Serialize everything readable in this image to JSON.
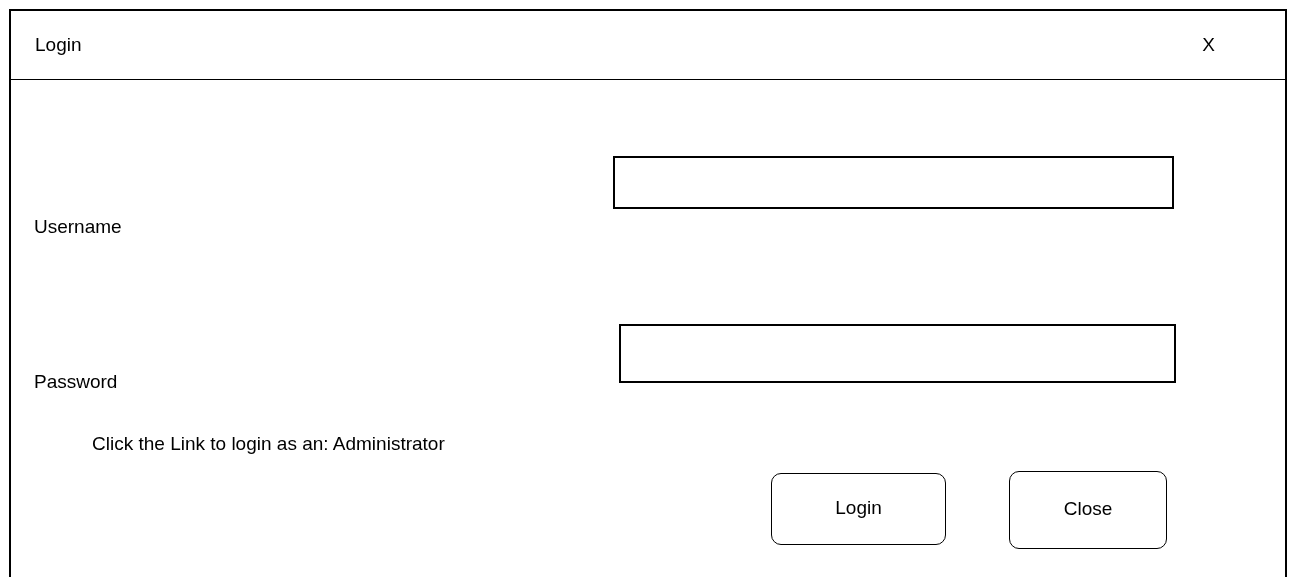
{
  "window": {
    "title": "Login",
    "close_label": "X"
  },
  "fields": [
    {
      "label": "Username"
    },
    {
      "label": "Password"
    }
  ],
  "admin_prompt": "Click the Link to login as an: Administrator",
  "buttons": [
    "Login",
    "Close"
  ]
}
